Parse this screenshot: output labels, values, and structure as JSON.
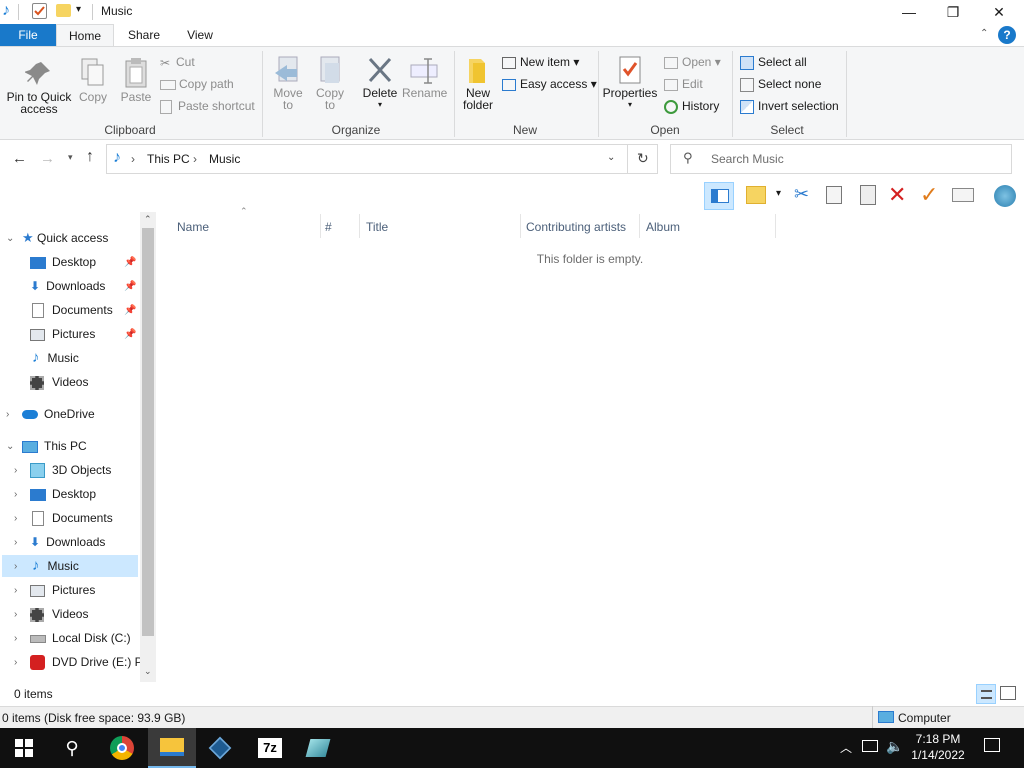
{
  "window": {
    "title": "Music",
    "controls": {
      "minimize": "—",
      "maximize": "❐",
      "close": "✕"
    }
  },
  "tabs": [
    {
      "label": "File"
    },
    {
      "label": "Home"
    },
    {
      "label": "Share"
    },
    {
      "label": "View"
    }
  ],
  "ribbon": {
    "clipboard": {
      "label": "Clipboard",
      "pin": "Pin to Quick",
      "pin2": "access",
      "copy": "Copy",
      "paste": "Paste",
      "cut": "Cut",
      "copy_path": "Copy path",
      "paste_shortcut": "Paste shortcut"
    },
    "organize": {
      "label": "Organize",
      "move_to": "Move",
      "move_to2": "to",
      "copy_to": "Copy",
      "copy_to2": "to",
      "delete": "Delete",
      "rename": "Rename"
    },
    "new": {
      "label": "New",
      "new_folder": "New",
      "new_folder2": "folder",
      "new_item": "New item",
      "easy_access": "Easy access"
    },
    "open": {
      "label": "Open",
      "properties": "Properties",
      "open": "Open",
      "edit": "Edit",
      "history": "History"
    },
    "select": {
      "label": "Select",
      "select_all": "Select all",
      "select_none": "Select none",
      "invert": "Invert selection"
    }
  },
  "address": {
    "crumbs": [
      "This PC",
      "Music"
    ],
    "search_placeholder": "Search Music"
  },
  "nav": {
    "quick_access": "Quick access",
    "quick_items": [
      {
        "label": "Desktop"
      },
      {
        "label": "Downloads"
      },
      {
        "label": "Documents"
      },
      {
        "label": "Pictures"
      },
      {
        "label": "Music"
      },
      {
        "label": "Videos"
      }
    ],
    "onedrive": "OneDrive",
    "this_pc": "This PC",
    "pc_items": [
      {
        "label": "3D Objects"
      },
      {
        "label": "Desktop"
      },
      {
        "label": "Documents"
      },
      {
        "label": "Downloads"
      },
      {
        "label": "Music"
      },
      {
        "label": "Pictures"
      },
      {
        "label": "Videos"
      },
      {
        "label": "Local Disk (C:)"
      },
      {
        "label": "DVD Drive (E:) P\\"
      }
    ]
  },
  "content": {
    "columns": [
      "Name",
      "#",
      "Title",
      "Contributing artists",
      "Album"
    ],
    "empty_message": "This folder is empty."
  },
  "status": {
    "items": "0 items",
    "disk": "0 items (Disk free space: 93.9 GB)",
    "location": "Computer"
  },
  "taskbar": {
    "time": "7:18 PM",
    "date": "1/14/2022"
  },
  "colors": {
    "accent": "#1979ca",
    "selection": "#cce8ff",
    "taskbar": "#101010"
  }
}
